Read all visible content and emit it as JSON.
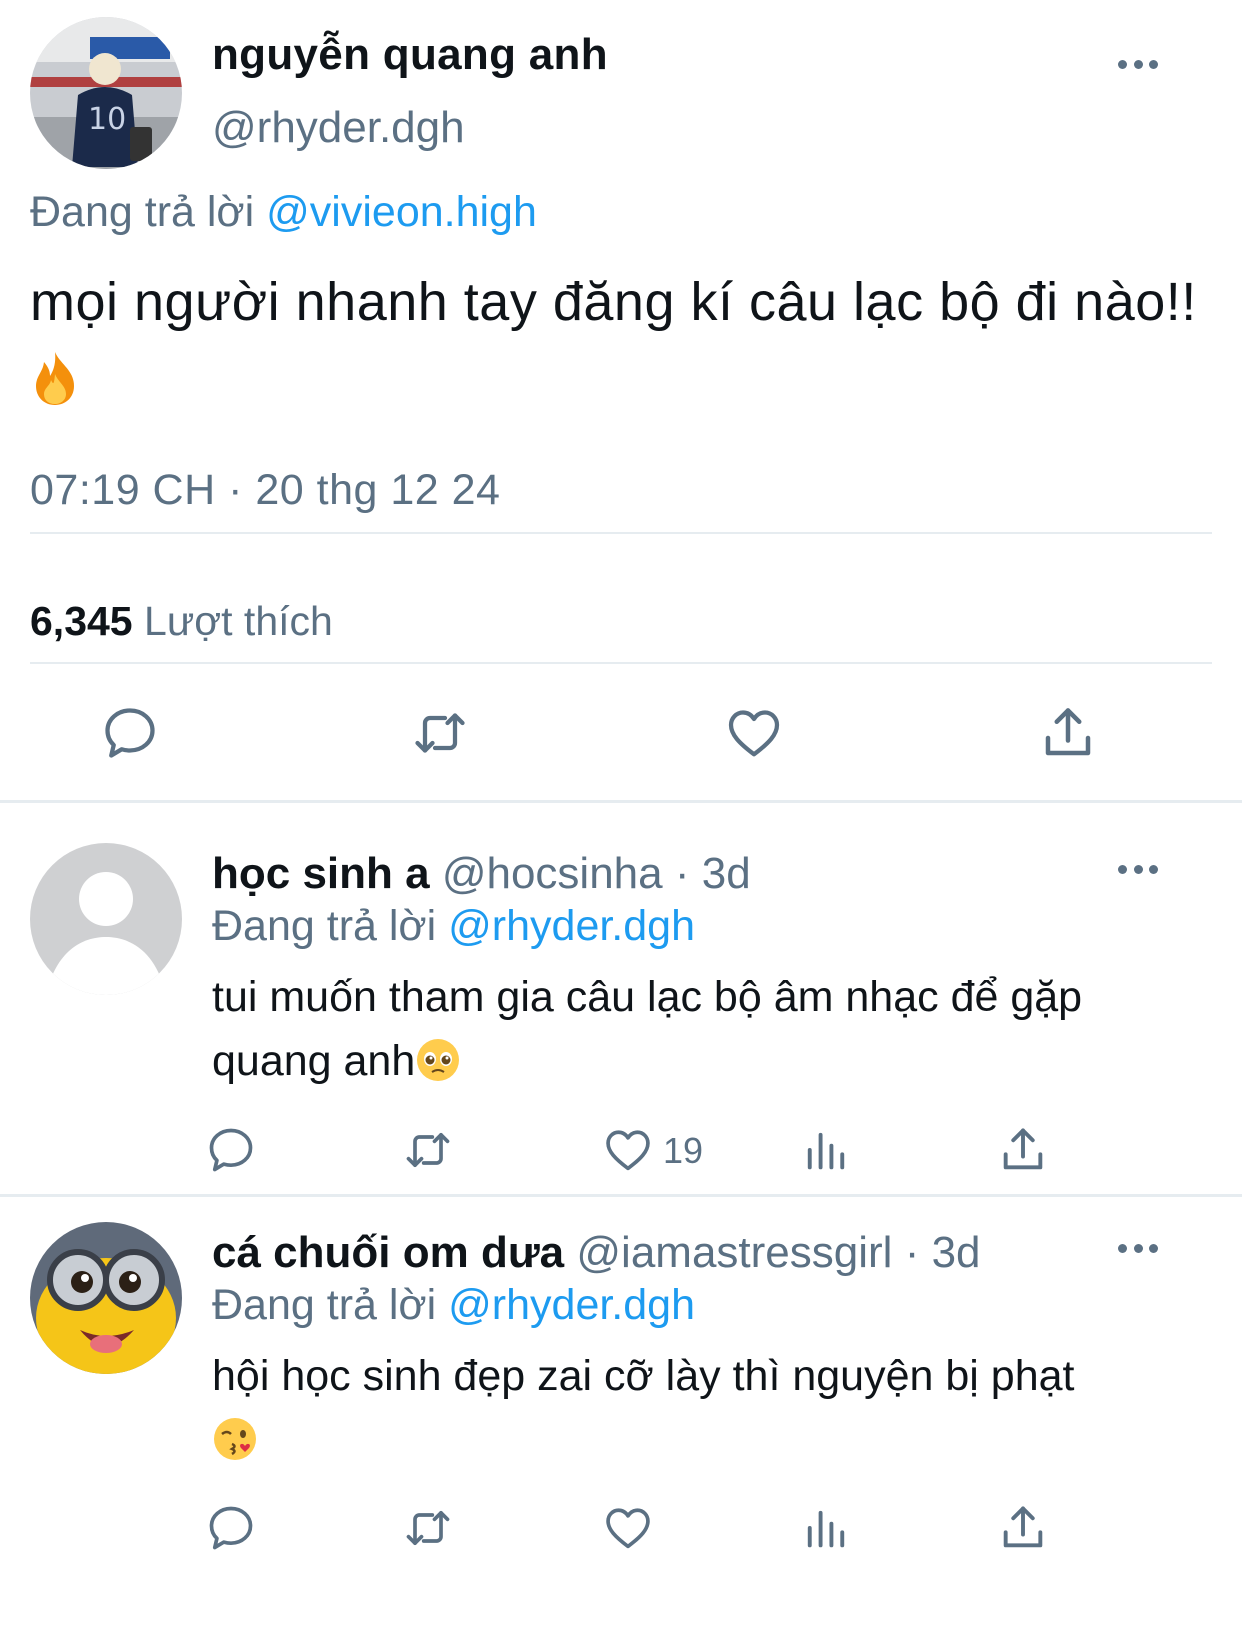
{
  "main": {
    "name": "nguyễn quang anh",
    "handle": "@rhyder.dgh",
    "replying_prefix": "Đang trả lời",
    "replying_to": "@vivieon.high",
    "text": "mọi người nhanh tay đăng kí câu lạc bộ đi nào!!",
    "time": "07:19 CH · 20 thg 12 24",
    "likes_count": "6,345",
    "likes_label": "Lượt thích",
    "avatar_icon": "user-photo-avatar",
    "emoji": "fire-emoji"
  },
  "replies": [
    {
      "name": "học sinh a",
      "handle": "@hocsinha",
      "sep": "·",
      "age": "3d",
      "replying_prefix": "Đang trả lời",
      "replying_to": "@rhyder.dgh",
      "text": "tui muốn tham gia câu lạc bộ âm nhạc để gặp quang anh",
      "emoji": "pleading-face-emoji",
      "like_count": "19",
      "avatar_icon": "default-avatar"
    },
    {
      "name": "cá chuối om dưa",
      "handle": "@iamastressgirl",
      "sep": "·",
      "age": "3d",
      "replying_prefix": "Đang trả lời",
      "replying_to": "@rhyder.dgh",
      "text": "hội học sinh đẹp zai cỡ lày thì nguyện bị phạt",
      "emoji": "kissing-face-emoji",
      "like_count": "",
      "avatar_icon": "cartoon-avatar"
    }
  ],
  "colors": {
    "accent": "#1d9bf0",
    "muted": "#5b7083",
    "divider": "#e6ecf0",
    "text": "#0f1419"
  }
}
